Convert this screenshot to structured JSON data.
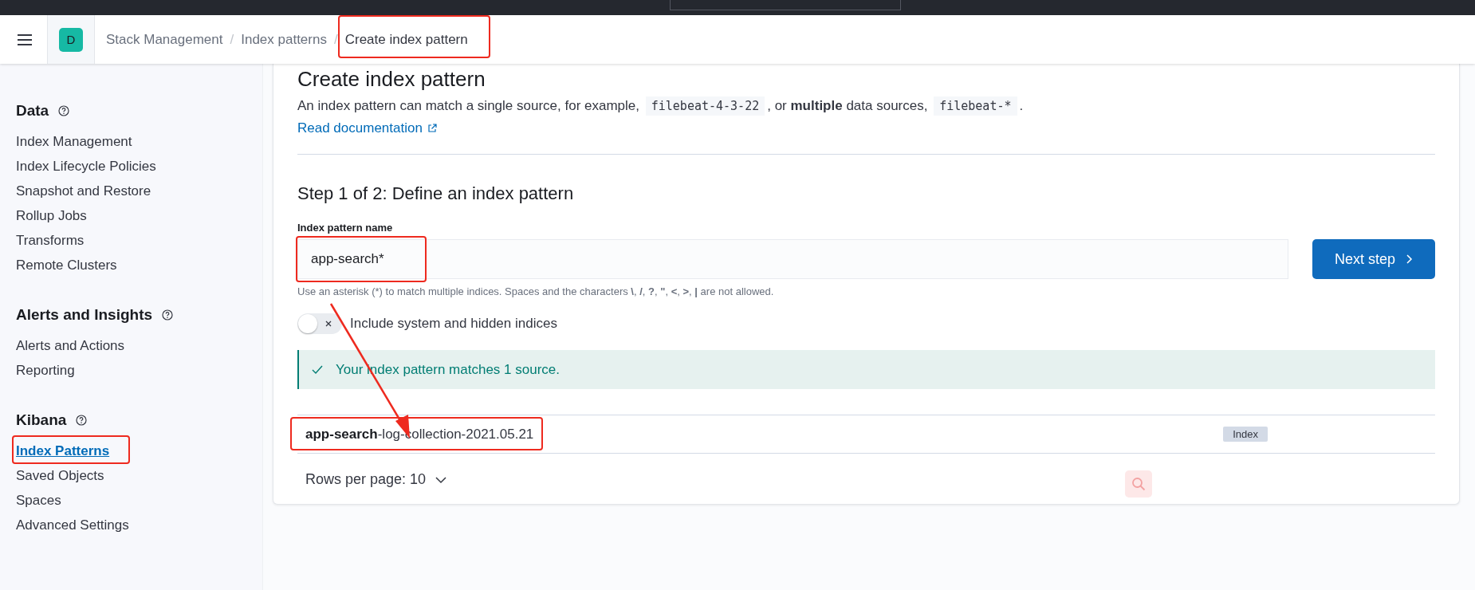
{
  "header": {
    "space_initial": "D",
    "breadcrumb_separator": "/",
    "breadcrumbs": [
      {
        "label": "Stack Management",
        "current": false,
        "highlighted": false
      },
      {
        "label": "Index patterns",
        "current": false,
        "highlighted": false
      },
      {
        "label": "Create index pattern",
        "current": true,
        "highlighted": true
      }
    ]
  },
  "sidebar": {
    "sections": [
      {
        "title": "Data",
        "items": [
          {
            "label": "Index Management",
            "selected": false,
            "highlighted": false
          },
          {
            "label": "Index Lifecycle Policies",
            "selected": false,
            "highlighted": false
          },
          {
            "label": "Snapshot and Restore",
            "selected": false,
            "highlighted": false
          },
          {
            "label": "Rollup Jobs",
            "selected": false,
            "highlighted": false
          },
          {
            "label": "Transforms",
            "selected": false,
            "highlighted": false
          },
          {
            "label": "Remote Clusters",
            "selected": false,
            "highlighted": false
          }
        ]
      },
      {
        "title": "Alerts and Insights",
        "items": [
          {
            "label": "Alerts and Actions",
            "selected": false,
            "highlighted": false
          },
          {
            "label": "Reporting",
            "selected": false,
            "highlighted": false
          }
        ]
      },
      {
        "title": "Kibana",
        "items": [
          {
            "label": "Index Patterns",
            "selected": true,
            "highlighted": true
          },
          {
            "label": "Saved Objects",
            "selected": false,
            "highlighted": false
          },
          {
            "label": "Spaces",
            "selected": false,
            "highlighted": false
          },
          {
            "label": "Advanced Settings",
            "selected": false,
            "highlighted": false
          }
        ]
      }
    ]
  },
  "page": {
    "title": "Create index pattern",
    "intro": [
      "An index pattern can match a single source, for example, ",
      "filebeat-4-3-22",
      ", or **multiple** data sources, ",
      "filebeat-*",
      "."
    ],
    "doc_link": "Read documentation",
    "step_title": "Step 1 of 2: Define an index pattern",
    "field": {
      "label": "Index pattern name",
      "value": "app-search*",
      "highlighted": true
    },
    "next_button": "Next step",
    "help": "Use an asterisk (*) to match multiple indices. Spaces and the characters **\\**, **/**, **?**, **\"**, **<**, **>**, **|** are not allowed.",
    "toggle": {
      "label": "Include system and hidden indices",
      "on": false
    },
    "callout": "Your index pattern matches 1 source.",
    "annotation_arrow": true,
    "results": [
      {
        "match": "app-search",
        "rest": "-log-collection-2021.05.21",
        "badge": "Index",
        "highlighted": true
      }
    ],
    "rows_per_page": "Rows per page: 10"
  }
}
